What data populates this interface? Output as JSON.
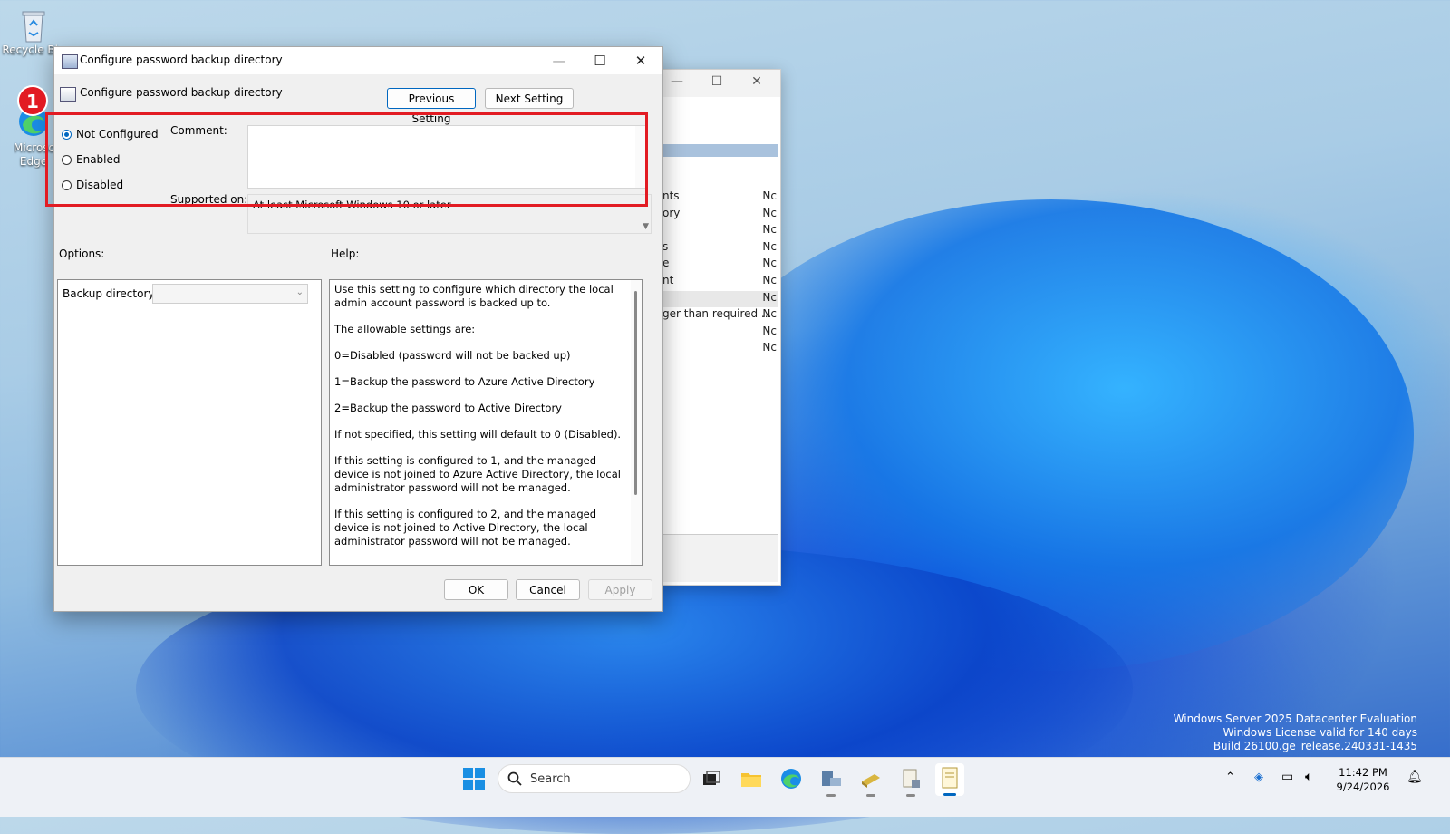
{
  "desktop": {
    "icons": [
      {
        "label": "Recycle Bin",
        "icon": "recycle-bin-icon"
      },
      {
        "label": "Microsoft Edge",
        "icon": "edge-icon"
      }
    ],
    "watermark": [
      "Windows Server 2025 Datacenter Evaluation",
      "Windows License valid for 140 days",
      "Build 26100.ge_release.240331-1435"
    ]
  },
  "background_window": {
    "rows": [
      {
        "text": "nts",
        "state": "Nc"
      },
      {
        "text": "ory",
        "state": "Nc"
      },
      {
        "text": "",
        "state": "Nc"
      },
      {
        "text": "s",
        "state": "Nc"
      },
      {
        "text": "e",
        "state": "Nc"
      },
      {
        "text": "nt",
        "state": "Nc"
      },
      {
        "text": "",
        "state": "Nc"
      },
      {
        "text": "ger than required ...",
        "state": "Nc"
      },
      {
        "text": "",
        "state": "Nc"
      },
      {
        "text": "",
        "state": "Nc"
      }
    ]
  },
  "dialog": {
    "window_title": "Configure password backup directory",
    "setting_title": "Configure password backup directory",
    "previous_button": "Previous Setting",
    "next_button": "Next Setting",
    "radios": [
      {
        "label": "Not Configured",
        "selected": true
      },
      {
        "label": "Enabled",
        "selected": false
      },
      {
        "label": "Disabled",
        "selected": false
      }
    ],
    "comment_label": "Comment:",
    "comment_value": "",
    "supported_label": "Supported on:",
    "supported_value": "At least Microsoft Windows 10 or later",
    "options_label": "Options:",
    "help_label": "Help:",
    "backup_directory_label": "Backup directory",
    "backup_directory_value": "",
    "help_paragraphs": [
      "Use this setting to configure which directory the local admin account password is backed up to.",
      "The allowable settings are:",
      "0=Disabled (password will not be backed up)",
      "1=Backup the password to Azure Active Directory",
      "2=Backup the password to Active Directory",
      "If not specified, this setting will default to 0 (Disabled).",
      "If this setting is configured to 1, and the managed device is not joined to Azure Active Directory, the local administrator password will not be managed.",
      "If this setting is configured to 2, and the managed device is not joined to Active Directory, the local administrator password will not be managed."
    ],
    "ok_button": "OK",
    "cancel_button": "Cancel",
    "apply_button": "Apply"
  },
  "annotation": {
    "badge": "1",
    "color": "#e21b23"
  },
  "taskbar": {
    "search_placeholder": "Search",
    "time": "11:42 PM",
    "date": "9/24/2026"
  },
  "colors": {
    "accent": "#0067c0"
  }
}
